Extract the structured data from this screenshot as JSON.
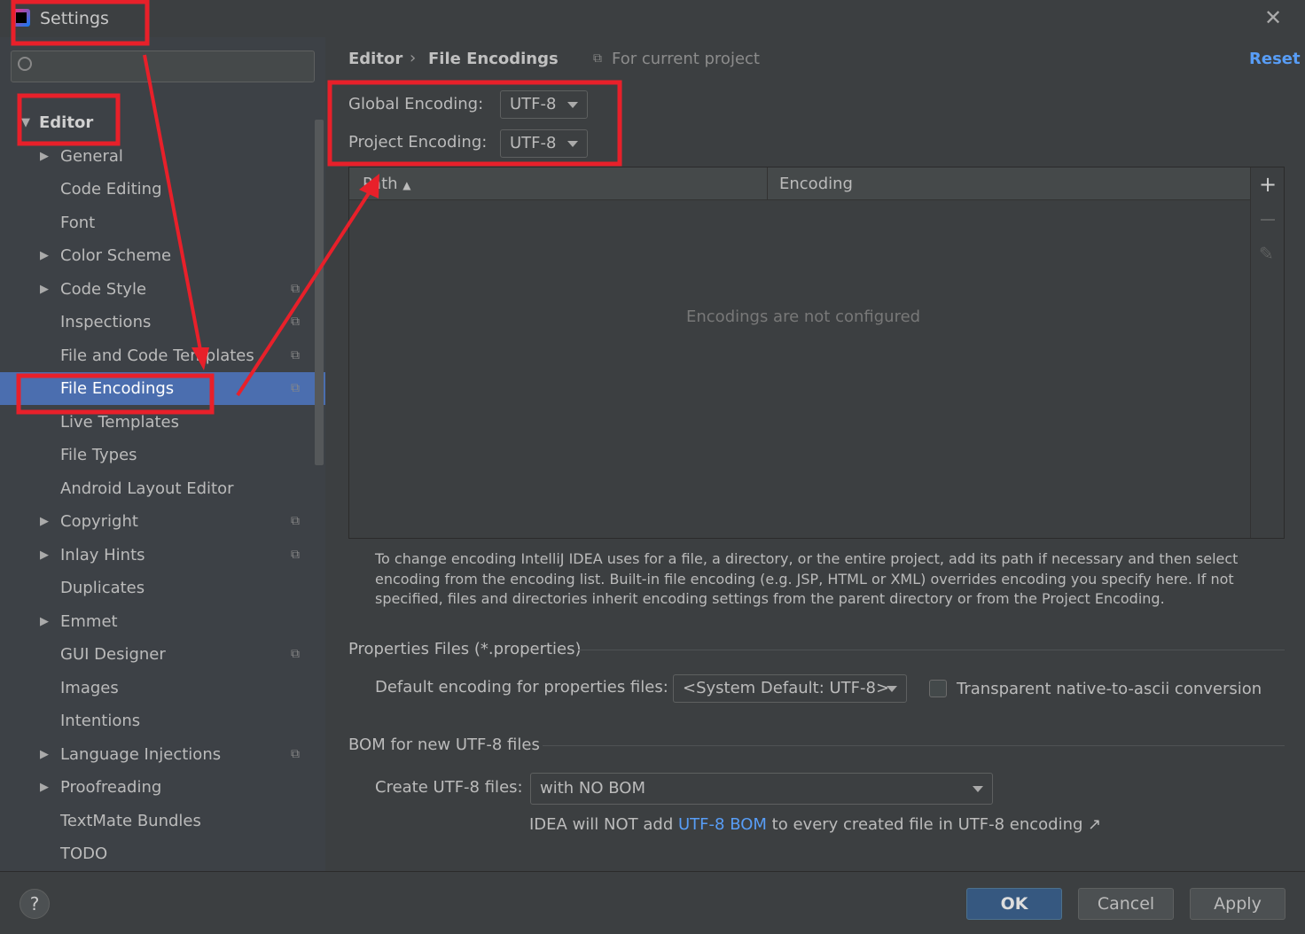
{
  "window": {
    "title": "Settings"
  },
  "sidebar": {
    "items": [
      {
        "label": "Editor",
        "bold": true,
        "expanded": true
      },
      {
        "label": "General",
        "arrow": true
      },
      {
        "label": "Code Editing"
      },
      {
        "label": "Font"
      },
      {
        "label": "Color Scheme",
        "arrow": true
      },
      {
        "label": "Code Style",
        "arrow": true,
        "project": true
      },
      {
        "label": "Inspections",
        "project": true
      },
      {
        "label": "File and Code Templates",
        "project": true
      },
      {
        "label": "File Encodings",
        "project": true,
        "selected": true
      },
      {
        "label": "Live Templates"
      },
      {
        "label": "File Types"
      },
      {
        "label": "Android Layout Editor"
      },
      {
        "label": "Copyright",
        "arrow": true,
        "project": true
      },
      {
        "label": "Inlay Hints",
        "arrow": true,
        "project": true
      },
      {
        "label": "Duplicates"
      },
      {
        "label": "Emmet",
        "arrow": true
      },
      {
        "label": "GUI Designer",
        "project": true
      },
      {
        "label": "Images"
      },
      {
        "label": "Intentions"
      },
      {
        "label": "Language Injections",
        "arrow": true,
        "project": true
      },
      {
        "label": "Proofreading",
        "arrow": true
      },
      {
        "label": "TextMate Bundles"
      },
      {
        "label": "TODO"
      }
    ]
  },
  "breadcrumb": {
    "parent": "Editor",
    "current": "File Encodings",
    "scope": "For current project",
    "reset": "Reset"
  },
  "encodings": {
    "global_label": "Global Encoding:",
    "global_value": "UTF-8",
    "project_label": "Project Encoding:",
    "project_value": "UTF-8"
  },
  "table": {
    "columns": [
      "Path",
      "Encoding"
    ],
    "empty": "Encodings are not configured"
  },
  "help_text": "To change encoding IntelliJ IDEA uses for a file, a directory, or the entire project, add its path if necessary and then select encoding from the encoding list. Built-in file encoding (e.g. JSP, HTML or XML) overrides encoding you specify here. If not specified, files and directories inherit encoding settings from the parent directory or from the Project Encoding.",
  "properties": {
    "title": "Properties Files (*.properties)",
    "default_label": "Default encoding for properties files:",
    "default_value": "<System Default: UTF-8>",
    "transparent_label": "Transparent native-to-ascii conversion",
    "transparent_checked": false
  },
  "bom": {
    "title": "BOM for new UTF-8 files",
    "create_label": "Create UTF-8 files:",
    "create_value": "with NO BOM",
    "note_pre": "IDEA will NOT add",
    "note_link": "UTF-8 BOM",
    "note_post": "to every created file in UTF-8 encoding ↗"
  },
  "buttons": {
    "ok": "OK",
    "cancel": "Cancel",
    "apply": "Apply",
    "help": "?"
  },
  "colors": {
    "selection": "#4b6eaf",
    "annotation": "#e8202a",
    "link": "#589df6"
  }
}
